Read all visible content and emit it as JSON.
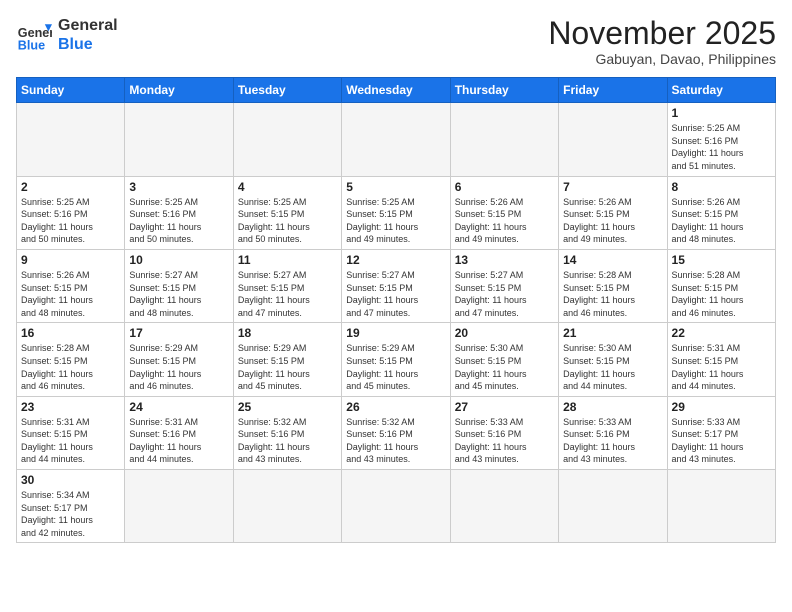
{
  "header": {
    "logo_general": "General",
    "logo_blue": "Blue",
    "month_title": "November 2025",
    "subtitle": "Gabuyan, Davao, Philippines"
  },
  "days_of_week": [
    "Sunday",
    "Monday",
    "Tuesday",
    "Wednesday",
    "Thursday",
    "Friday",
    "Saturday"
  ],
  "weeks": [
    [
      {
        "day": "",
        "info": ""
      },
      {
        "day": "",
        "info": ""
      },
      {
        "day": "",
        "info": ""
      },
      {
        "day": "",
        "info": ""
      },
      {
        "day": "",
        "info": ""
      },
      {
        "day": "",
        "info": ""
      },
      {
        "day": "1",
        "info": "Sunrise: 5:25 AM\nSunset: 5:16 PM\nDaylight: 11 hours\nand 51 minutes."
      }
    ],
    [
      {
        "day": "2",
        "info": "Sunrise: 5:25 AM\nSunset: 5:16 PM\nDaylight: 11 hours\nand 50 minutes."
      },
      {
        "day": "3",
        "info": "Sunrise: 5:25 AM\nSunset: 5:16 PM\nDaylight: 11 hours\nand 50 minutes."
      },
      {
        "day": "4",
        "info": "Sunrise: 5:25 AM\nSunset: 5:15 PM\nDaylight: 11 hours\nand 50 minutes."
      },
      {
        "day": "5",
        "info": "Sunrise: 5:25 AM\nSunset: 5:15 PM\nDaylight: 11 hours\nand 49 minutes."
      },
      {
        "day": "6",
        "info": "Sunrise: 5:26 AM\nSunset: 5:15 PM\nDaylight: 11 hours\nand 49 minutes."
      },
      {
        "day": "7",
        "info": "Sunrise: 5:26 AM\nSunset: 5:15 PM\nDaylight: 11 hours\nand 49 minutes."
      },
      {
        "day": "8",
        "info": "Sunrise: 5:26 AM\nSunset: 5:15 PM\nDaylight: 11 hours\nand 48 minutes."
      }
    ],
    [
      {
        "day": "9",
        "info": "Sunrise: 5:26 AM\nSunset: 5:15 PM\nDaylight: 11 hours\nand 48 minutes."
      },
      {
        "day": "10",
        "info": "Sunrise: 5:27 AM\nSunset: 5:15 PM\nDaylight: 11 hours\nand 48 minutes."
      },
      {
        "day": "11",
        "info": "Sunrise: 5:27 AM\nSunset: 5:15 PM\nDaylight: 11 hours\nand 47 minutes."
      },
      {
        "day": "12",
        "info": "Sunrise: 5:27 AM\nSunset: 5:15 PM\nDaylight: 11 hours\nand 47 minutes."
      },
      {
        "day": "13",
        "info": "Sunrise: 5:27 AM\nSunset: 5:15 PM\nDaylight: 11 hours\nand 47 minutes."
      },
      {
        "day": "14",
        "info": "Sunrise: 5:28 AM\nSunset: 5:15 PM\nDaylight: 11 hours\nand 46 minutes."
      },
      {
        "day": "15",
        "info": "Sunrise: 5:28 AM\nSunset: 5:15 PM\nDaylight: 11 hours\nand 46 minutes."
      }
    ],
    [
      {
        "day": "16",
        "info": "Sunrise: 5:28 AM\nSunset: 5:15 PM\nDaylight: 11 hours\nand 46 minutes."
      },
      {
        "day": "17",
        "info": "Sunrise: 5:29 AM\nSunset: 5:15 PM\nDaylight: 11 hours\nand 46 minutes."
      },
      {
        "day": "18",
        "info": "Sunrise: 5:29 AM\nSunset: 5:15 PM\nDaylight: 11 hours\nand 45 minutes."
      },
      {
        "day": "19",
        "info": "Sunrise: 5:29 AM\nSunset: 5:15 PM\nDaylight: 11 hours\nand 45 minutes."
      },
      {
        "day": "20",
        "info": "Sunrise: 5:30 AM\nSunset: 5:15 PM\nDaylight: 11 hours\nand 45 minutes."
      },
      {
        "day": "21",
        "info": "Sunrise: 5:30 AM\nSunset: 5:15 PM\nDaylight: 11 hours\nand 44 minutes."
      },
      {
        "day": "22",
        "info": "Sunrise: 5:31 AM\nSunset: 5:15 PM\nDaylight: 11 hours\nand 44 minutes."
      }
    ],
    [
      {
        "day": "23",
        "info": "Sunrise: 5:31 AM\nSunset: 5:15 PM\nDaylight: 11 hours\nand 44 minutes."
      },
      {
        "day": "24",
        "info": "Sunrise: 5:31 AM\nSunset: 5:16 PM\nDaylight: 11 hours\nand 44 minutes."
      },
      {
        "day": "25",
        "info": "Sunrise: 5:32 AM\nSunset: 5:16 PM\nDaylight: 11 hours\nand 43 minutes."
      },
      {
        "day": "26",
        "info": "Sunrise: 5:32 AM\nSunset: 5:16 PM\nDaylight: 11 hours\nand 43 minutes."
      },
      {
        "day": "27",
        "info": "Sunrise: 5:33 AM\nSunset: 5:16 PM\nDaylight: 11 hours\nand 43 minutes."
      },
      {
        "day": "28",
        "info": "Sunrise: 5:33 AM\nSunset: 5:16 PM\nDaylight: 11 hours\nand 43 minutes."
      },
      {
        "day": "29",
        "info": "Sunrise: 5:33 AM\nSunset: 5:17 PM\nDaylight: 11 hours\nand 43 minutes."
      }
    ],
    [
      {
        "day": "30",
        "info": "Sunrise: 5:34 AM\nSunset: 5:17 PM\nDaylight: 11 hours\nand 42 minutes."
      },
      {
        "day": "",
        "info": ""
      },
      {
        "day": "",
        "info": ""
      },
      {
        "day": "",
        "info": ""
      },
      {
        "day": "",
        "info": ""
      },
      {
        "day": "",
        "info": ""
      },
      {
        "day": "",
        "info": ""
      }
    ]
  ]
}
